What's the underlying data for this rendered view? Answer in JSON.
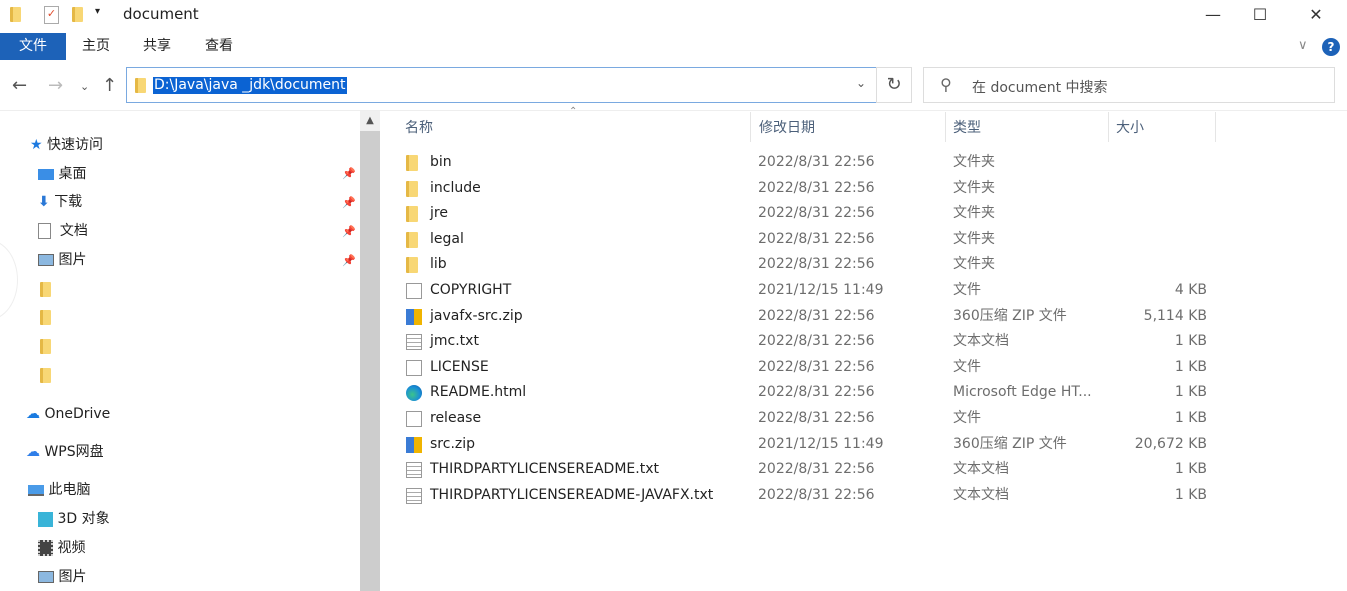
{
  "window": {
    "title": "document",
    "minimize": "—",
    "maximize": "☐",
    "close": "✕"
  },
  "ribbon": {
    "tabs": [
      "文件",
      "主页",
      "共享",
      "查看"
    ]
  },
  "address": {
    "path": "D:\\Java\\java _jdk\\document",
    "search_placeholder": "在 document 中搜索"
  },
  "sidebar": {
    "quick_access": "快速访问",
    "pinned": [
      {
        "label": "桌面",
        "icon": "desktop-icon"
      },
      {
        "label": "下载",
        "icon": "download-icon"
      },
      {
        "label": "文档",
        "icon": "documents-icon"
      },
      {
        "label": "图片",
        "icon": "pictures-icon"
      }
    ],
    "onedrive": "OneDrive",
    "wps": "WPS网盘",
    "this_pc": "此电脑",
    "pc_items": [
      {
        "label": "3D 对象",
        "icon": "3d-objects-icon"
      },
      {
        "label": "视频",
        "icon": "videos-icon"
      },
      {
        "label": "图片",
        "icon": "pictures-icon"
      }
    ]
  },
  "columns": {
    "name": "名称",
    "date": "修改日期",
    "type": "类型",
    "size": "大小"
  },
  "files": [
    {
      "name": "bin",
      "date": "2022/8/31 22:56",
      "type": "文件夹",
      "size": "",
      "icon": "folder"
    },
    {
      "name": "include",
      "date": "2022/8/31 22:56",
      "type": "文件夹",
      "size": "",
      "icon": "folder"
    },
    {
      "name": "jre",
      "date": "2022/8/31 22:56",
      "type": "文件夹",
      "size": "",
      "icon": "folder"
    },
    {
      "name": "legal",
      "date": "2022/8/31 22:56",
      "type": "文件夹",
      "size": "",
      "icon": "folder"
    },
    {
      "name": "lib",
      "date": "2022/8/31 22:56",
      "type": "文件夹",
      "size": "",
      "icon": "folder"
    },
    {
      "name": "COPYRIGHT",
      "date": "2021/12/15 11:49",
      "type": "文件",
      "size": "4 KB",
      "icon": "doc"
    },
    {
      "name": "javafx-src.zip",
      "date": "2022/8/31 22:56",
      "type": "360压缩 ZIP 文件",
      "size": "5,114 KB",
      "icon": "zip"
    },
    {
      "name": "jmc.txt",
      "date": "2022/8/31 22:56",
      "type": "文本文档",
      "size": "1 KB",
      "icon": "txt"
    },
    {
      "name": "LICENSE",
      "date": "2022/8/31 22:56",
      "type": "文件",
      "size": "1 KB",
      "icon": "doc"
    },
    {
      "name": "README.html",
      "date": "2022/8/31 22:56",
      "type": "Microsoft Edge HT...",
      "size": "1 KB",
      "icon": "edge"
    },
    {
      "name": "release",
      "date": "2022/8/31 22:56",
      "type": "文件",
      "size": "1 KB",
      "icon": "doc"
    },
    {
      "name": "src.zip",
      "date": "2021/12/15 11:49",
      "type": "360压缩 ZIP 文件",
      "size": "20,672 KB",
      "icon": "zip"
    },
    {
      "name": "THIRDPARTYLICENSEREADME.txt",
      "date": "2022/8/31 22:56",
      "type": "文本文档",
      "size": "1 KB",
      "icon": "txt"
    },
    {
      "name": "THIRDPARTYLICENSEREADME-JAVAFX.txt",
      "date": "2022/8/31 22:56",
      "type": "文本文档",
      "size": "1 KB",
      "icon": "txt"
    }
  ]
}
